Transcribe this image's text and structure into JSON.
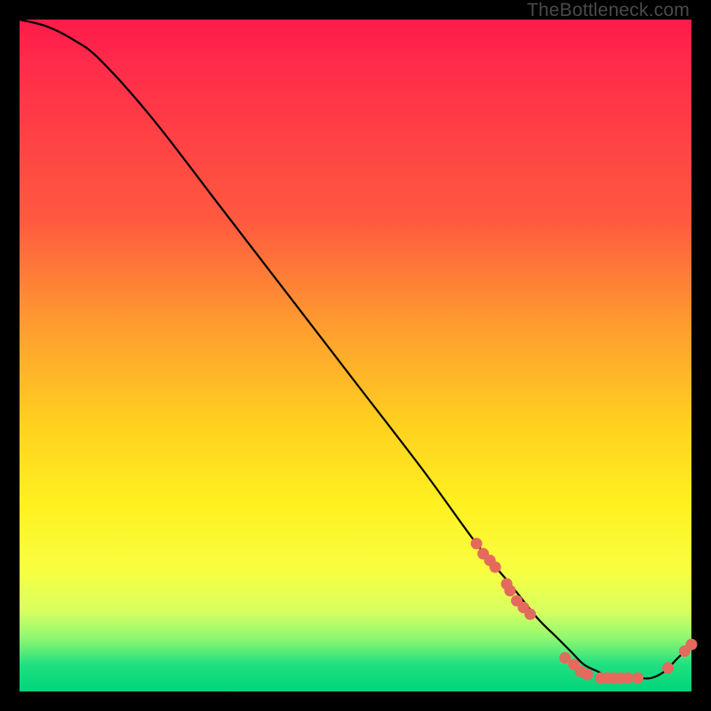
{
  "watermark": "TheBottleneck.com",
  "chart_data": {
    "type": "line",
    "title": "",
    "xlabel": "",
    "ylabel": "",
    "xlim": [
      0,
      100
    ],
    "ylim": [
      0,
      100
    ],
    "grid": false,
    "legend": false,
    "series": [
      {
        "name": "bottleneck-curve",
        "x": [
          0,
          4,
          8,
          12,
          20,
          30,
          40,
          50,
          60,
          68,
          73,
          77,
          80,
          82,
          84,
          86,
          88,
          90,
          92,
          94,
          96,
          98,
          100
        ],
        "y": [
          100,
          99,
          97,
          94,
          85,
          72,
          59,
          46,
          33,
          22,
          16,
          11,
          8,
          6,
          4,
          3,
          2,
          2,
          2,
          2,
          3,
          5,
          7
        ]
      }
    ],
    "markers": [
      {
        "x": 68.0,
        "y": 22.0
      },
      {
        "x": 69.0,
        "y": 20.5
      },
      {
        "x": 70.0,
        "y": 19.5
      },
      {
        "x": 70.8,
        "y": 18.5
      },
      {
        "x": 72.5,
        "y": 16.0
      },
      {
        "x": 73.0,
        "y": 15.0
      },
      {
        "x": 74.0,
        "y": 13.5
      },
      {
        "x": 75.0,
        "y": 12.5
      },
      {
        "x": 76.0,
        "y": 11.5
      },
      {
        "x": 81.2,
        "y": 5.0
      },
      {
        "x": 82.5,
        "y": 4.0
      },
      {
        "x": 83.5,
        "y": 3.0
      },
      {
        "x": 84.5,
        "y": 2.5
      },
      {
        "x": 86.5,
        "y": 2.0
      },
      {
        "x": 87.5,
        "y": 2.0
      },
      {
        "x": 88.5,
        "y": 2.0
      },
      {
        "x": 89.5,
        "y": 2.0
      },
      {
        "x": 90.5,
        "y": 2.0
      },
      {
        "x": 92.0,
        "y": 2.0
      },
      {
        "x": 96.5,
        "y": 3.5
      },
      {
        "x": 99.0,
        "y": 6.0
      },
      {
        "x": 100.0,
        "y": 7.0
      }
    ],
    "marker_color": "#e46a5e",
    "line_color": "#000000"
  }
}
